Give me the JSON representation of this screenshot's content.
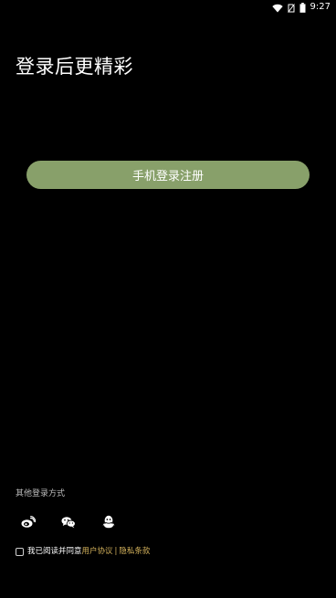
{
  "status_bar": {
    "time": "9:27",
    "icons": [
      "wifi-icon",
      "no-sim-icon",
      "battery-icon"
    ]
  },
  "headline": "登录后更精彩",
  "primary_button": {
    "label": "手机登录注册",
    "color": "#88a06a"
  },
  "other_login": {
    "label": "其他登录方式",
    "providers": [
      "weibo-icon",
      "wechat-icon",
      "qq-icon"
    ]
  },
  "agreement": {
    "prefix": "我已阅读并同意",
    "user_agreement": "用户协议",
    "separator": "|",
    "privacy_policy": "隐私条款",
    "link_color": "#d4b25c",
    "checked": false
  }
}
